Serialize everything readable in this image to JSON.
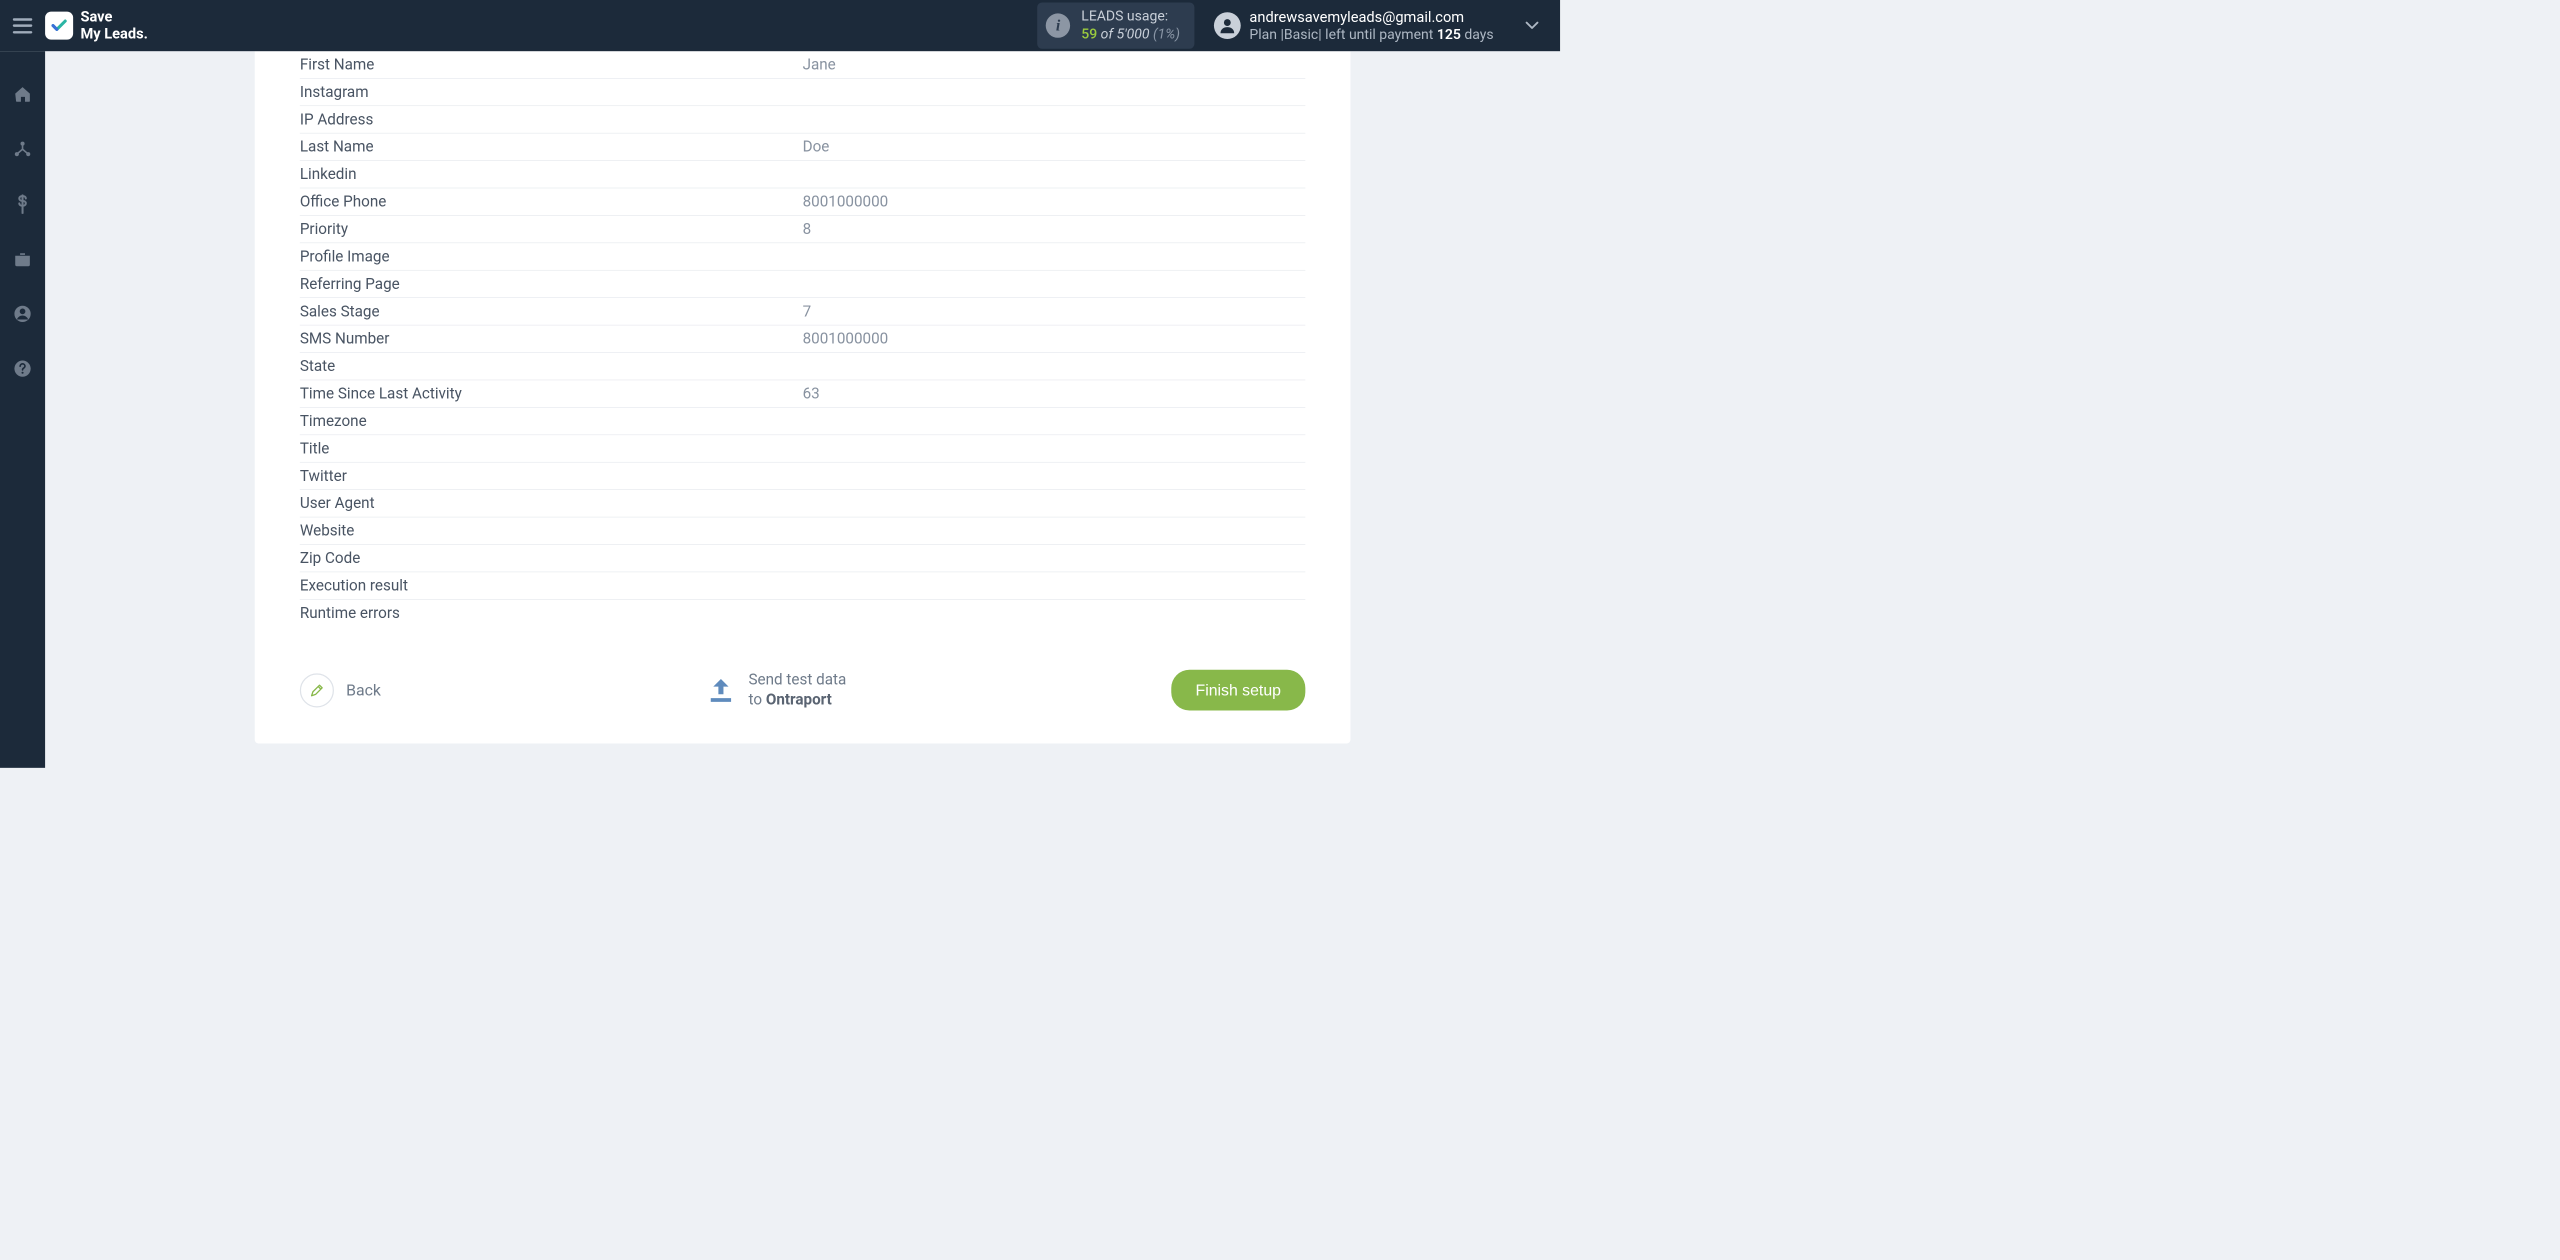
{
  "brand": {
    "line1": "Save",
    "line2": "My Leads."
  },
  "leads": {
    "label": "LEADS usage:",
    "used": "59",
    "of": " of ",
    "total": "5'000",
    "pct": " (1%)"
  },
  "account": {
    "email": "andrewsavemyleads@gmail.com",
    "plan_prefix": "Plan |",
    "plan_name": "Basic",
    "plan_mid": "| left until payment ",
    "days": "125",
    "days_suffix": " days"
  },
  "rows": [
    {
      "k": "First Name",
      "v": "Jane"
    },
    {
      "k": "Instagram",
      "v": ""
    },
    {
      "k": "IP Address",
      "v": ""
    },
    {
      "k": "Last Name",
      "v": "Doe"
    },
    {
      "k": "Linkedin",
      "v": ""
    },
    {
      "k": "Office Phone",
      "v": "8001000000"
    },
    {
      "k": "Priority",
      "v": "8"
    },
    {
      "k": "Profile Image",
      "v": ""
    },
    {
      "k": "Referring Page",
      "v": ""
    },
    {
      "k": "Sales Stage",
      "v": "7"
    },
    {
      "k": "SMS Number",
      "v": "8001000000"
    },
    {
      "k": "State",
      "v": ""
    },
    {
      "k": "Time Since Last Activity",
      "v": "63"
    },
    {
      "k": "Timezone",
      "v": ""
    },
    {
      "k": "Title",
      "v": ""
    },
    {
      "k": "Twitter",
      "v": ""
    },
    {
      "k": "User Agent",
      "v": ""
    },
    {
      "k": "Website",
      "v": ""
    },
    {
      "k": "Zip Code",
      "v": ""
    },
    {
      "k": "Execution result",
      "v": ""
    },
    {
      "k": "Runtime errors",
      "v": ""
    }
  ],
  "footer": {
    "back": "Back",
    "send_line1": "Send test data",
    "send_line2_prefix": "to ",
    "send_target": "Ontraport",
    "finish": "Finish setup"
  }
}
